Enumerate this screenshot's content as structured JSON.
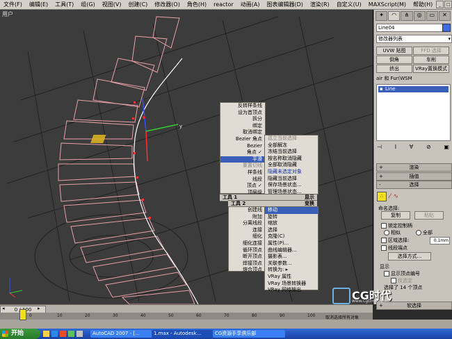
{
  "menubar": {
    "items": [
      "文件(F)",
      "编辑(E)",
      "工具(T)",
      "组(G)",
      "视图(V)",
      "创建(C)",
      "修改器(O)",
      "角色(H)",
      "reactor",
      "动画(A)",
      "图表编辑器(D)",
      "渲染(R)",
      "自定义(U)",
      "MAXScript(M)",
      "帮助(H)"
    ]
  },
  "viewport": {
    "label": "用户"
  },
  "quad_top_right": {
    "items": [
      {
        "label": "孤立当前选择",
        "dim": true
      },
      {
        "label": "全部解冻"
      },
      {
        "label": "冻结当前选择"
      },
      {
        "label": "按名称取消隐藏"
      },
      {
        "label": "全部取消隐藏"
      },
      {
        "label": "隐藏未选定对象",
        "highlight_blue": true
      },
      {
        "label": "隐藏当前选择"
      },
      {
        "label": "保存场景状态..."
      },
      {
        "label": "管理场景状态..."
      }
    ],
    "header": "显示"
  },
  "quad_top_left": {
    "items": [
      {
        "label": "反转样条线"
      },
      {
        "label": "设为首顶点"
      },
      {
        "label": "拆分"
      },
      {
        "label": "绑定"
      },
      {
        "label": "取消绑定"
      },
      {
        "label": "Bezier 角点"
      },
      {
        "label": "Bezier"
      },
      {
        "label": "角点 ✓"
      },
      {
        "label": "平滑",
        "highlight": true
      },
      {
        "label": "重置切线",
        "dim": true
      },
      {
        "label": "样条线"
      },
      {
        "label": "线段"
      },
      {
        "label": "顶点 ✓"
      },
      {
        "label": "顶层级"
      }
    ],
    "header": "工具 1"
  },
  "quad_bottom_left": {
    "header": "工具 2",
    "items": [
      {
        "label": "创建线"
      },
      {
        "label": "附加"
      },
      {
        "label": "分离线段"
      },
      {
        "label": "连接"
      },
      {
        "label": "细化"
      },
      {
        "label": "细化连接"
      },
      {
        "label": "循环顶点"
      },
      {
        "label": "断开顶点"
      },
      {
        "label": "焊接顶点"
      },
      {
        "label": "熔合顶点"
      }
    ]
  },
  "quad_bottom_right": {
    "header": "变换",
    "items": [
      {
        "label": "移动",
        "highlight": true
      },
      {
        "label": "旋转"
      },
      {
        "label": "缩放"
      },
      {
        "label": "选择"
      },
      {
        "label": "克隆(C)"
      },
      {
        "label": "属性(P)..."
      },
      {
        "label": "曲线编辑器..."
      },
      {
        "label": "摄影表..."
      },
      {
        "label": "关联参数..."
      },
      {
        "label": "转换为: ▸"
      },
      {
        "label": "VRay 属性"
      },
      {
        "label": "VRay 场景转换器"
      },
      {
        "label": "VRay 网格输出"
      }
    ]
  },
  "cmdpanel": {
    "object_name": "Line04",
    "modifier_list": "修改器列表",
    "buttons": [
      "UVW 贴图",
      "FFD 选择",
      "倒角",
      "车削",
      "挤出",
      "VRay置换模式"
    ],
    "hair_label": "air 和 Fur(WSM",
    "stack_item": "Line",
    "rollouts": {
      "render": "渲染",
      "interp": "插值",
      "select": "选择"
    },
    "named_sel_label": "命名选择:",
    "copy": "复制",
    "paste": "粘贴",
    "lock_handles": "锁定控制柄",
    "similar": "相似",
    "all": "全部",
    "area_select": "区域选择:",
    "area_value": "0.1mm",
    "segment_end": "线段端点",
    "select_by": "选择方式...",
    "display_label": "显示",
    "show_vertex_num": "显示顶点编号",
    "only_selected": "仅选定",
    "selected_count": "选择了 14 个顶点",
    "soft_sel": "软选择"
  },
  "timeline": {
    "frame": "0 / 100"
  },
  "ruler": {
    "ticks": [
      "0",
      "10",
      "20",
      "30",
      "40",
      "50",
      "60",
      "70",
      "80",
      "90",
      "100"
    ]
  },
  "statusbar": {
    "text": "取消选择所有对象"
  },
  "taskbar": {
    "start": "开始",
    "items": [
      "AutoCAD 2007 - [...",
      "1.max - Autodesk...",
      "CG资源手享俱乐部"
    ]
  },
  "watermark": {
    "text": "CG时代",
    "sub": "www.cgtimes.cn"
  },
  "colors": {
    "spline": "#e8a0a8",
    "highlight": "#3a5fb8",
    "panel": "#c8c4bc"
  }
}
